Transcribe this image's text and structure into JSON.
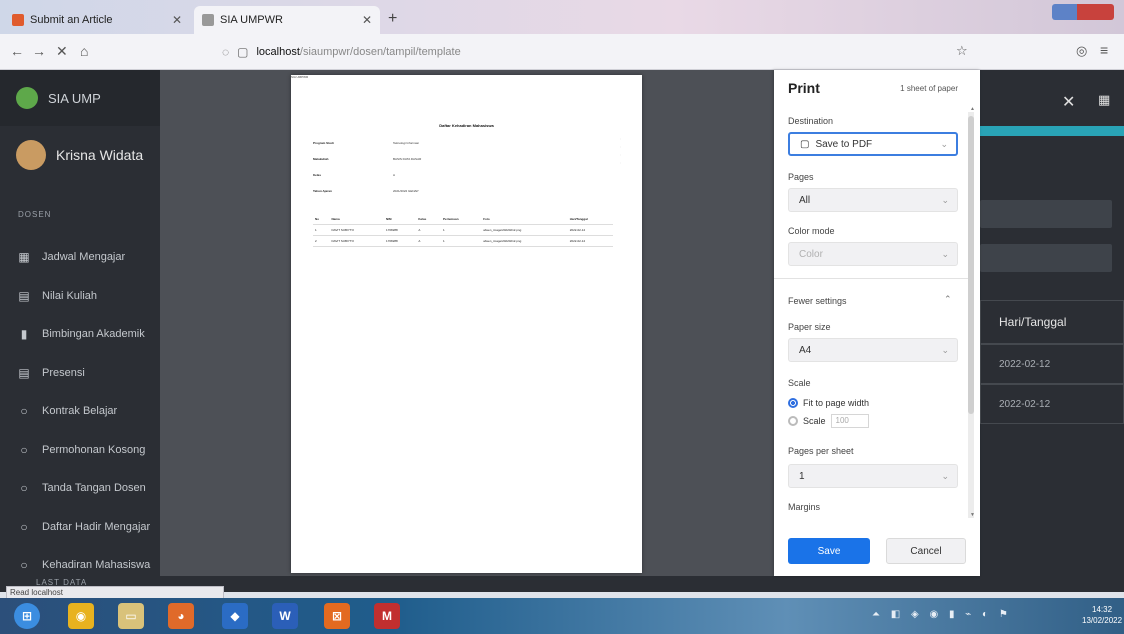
{
  "browser": {
    "tabs": [
      {
        "label": "Submit an Article",
        "favicon_color": "#e05b2d"
      },
      {
        "label": "SIA UMPWR",
        "favicon_color": "#999999"
      }
    ],
    "url": {
      "host": "localhost",
      "path": "/siaumpwr/dosen/tampil/template"
    }
  },
  "app": {
    "brand": "SIA UMP",
    "user": "Krisna Widata",
    "section": "DOSEN",
    "menu": [
      {
        "icon": "calendar-icon",
        "glyph": "▦",
        "label": "Jadwal Mengajar"
      },
      {
        "icon": "grades-icon",
        "glyph": "▤",
        "label": "Nilai Kuliah"
      },
      {
        "icon": "book-icon",
        "glyph": "▮",
        "label": "Bimbingan Akademik"
      },
      {
        "icon": "attendance-icon",
        "glyph": "▤",
        "label": "Presensi"
      },
      {
        "icon": "circle-icon",
        "glyph": "○",
        "label": "Kontrak Belajar"
      },
      {
        "icon": "circle-icon",
        "glyph": "○",
        "label": "Permohonan Kosong"
      },
      {
        "icon": "circle-icon",
        "glyph": "○",
        "label": "Tanda Tangan Dosen"
      },
      {
        "icon": "circle-icon",
        "glyph": "○",
        "label": "Daftar Hadir Mengajar"
      },
      {
        "icon": "circle-icon",
        "glyph": "○",
        "label": "Kehadiran Mahasiswa"
      }
    ],
    "last_section": "LAST DATA",
    "table_header": "Hari/Tanggal",
    "table_rows": [
      "2022-02-12",
      "2022-02-12"
    ],
    "accent_color": "#29a3b6"
  },
  "document": {
    "header_small": "SIA UMPWR",
    "title": "Daftar Kehadiran Mahasiswa",
    "fields": [
      {
        "key": "Program Studi",
        "value": "Teknologi Informasi"
      },
      {
        "key": "Matakuliah",
        "value": "BASIS DATA DASAR"
      },
      {
        "key": "Kelas",
        "value": "A"
      },
      {
        "key": "Tahun Ajaran",
        "value": "2021/2022 GENAP"
      }
    ],
    "table": {
      "headers": [
        "No",
        "Nama",
        "NIM",
        "Kelas",
        "Pertemuan",
        "Foto",
        "Hari/Tanggal"
      ],
      "rows": [
        [
          "1",
          "DAVIT SUBIYTO",
          "1708288",
          "A",
          "1",
          "absen_image/20220212.png",
          "2022-02-12"
        ],
        [
          "2",
          "DAVIT SUBIYTO",
          "1708288",
          "A",
          "1",
          "absen_image/20220212.png",
          "2022-02-12"
        ]
      ]
    }
  },
  "print": {
    "title": "Print",
    "sheets": "1 sheet of paper",
    "destination_label": "Destination",
    "destination_value": "Save to PDF",
    "pages_label": "Pages",
    "pages_value": "All",
    "color_label": "Color mode",
    "color_value": "Color",
    "fewer_label": "Fewer settings",
    "paper_label": "Paper size",
    "paper_value": "A4",
    "scale_label": "Scale",
    "fit_option": "Fit to page width",
    "scale_option": "Scale",
    "scale_value": "100",
    "pps_label": "Pages per sheet",
    "pps_value": "1",
    "margins_label": "Margins",
    "save_label": "Save",
    "cancel_label": "Cancel"
  },
  "status": "Read localhost",
  "taskbar": {
    "apps": [
      {
        "name": "start-orb",
        "color": "#3b8de0",
        "glyph": "⊞"
      },
      {
        "name": "chrome",
        "color": "#e8b21f",
        "glyph": "◉"
      },
      {
        "name": "explorer",
        "color": "#d9c27a",
        "glyph": "▭"
      },
      {
        "name": "firefox",
        "color": "#e06a2a",
        "glyph": "◕"
      },
      {
        "name": "virtualbox",
        "color": "#2b6cc4",
        "glyph": "◆"
      },
      {
        "name": "word",
        "color": "#2b5fb8",
        "glyph": "W"
      },
      {
        "name": "xampp",
        "color": "#e36a20",
        "glyph": "⊠"
      },
      {
        "name": "app-red",
        "color": "#c22f2f",
        "glyph": "M"
      }
    ],
    "clock_time": "14:32",
    "clock_date": "13/02/2022"
  }
}
